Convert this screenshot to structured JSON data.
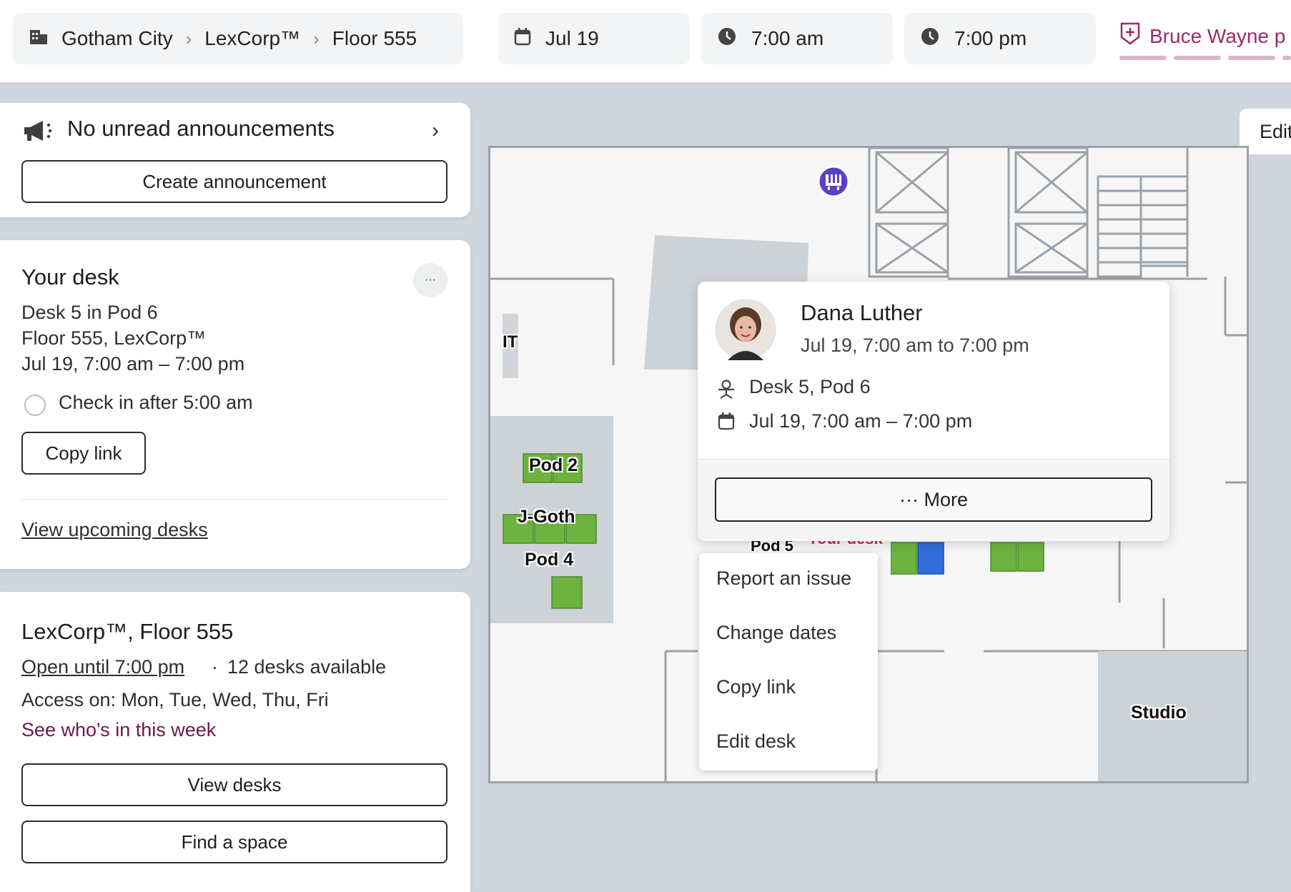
{
  "breadcrumb": [
    "Gotham City",
    "LexCorp™",
    "Floor 555"
  ],
  "filters": {
    "date": "Jul 19",
    "start_time": "7:00 am",
    "end_time": "7:00 pm"
  },
  "user": {
    "name": "Bruce Wayne p"
  },
  "announcements": {
    "title": "No unread announcements",
    "create_button": "Create announcement"
  },
  "your_desk": {
    "title": "Your desk",
    "more_glyph": "···",
    "desk_line": "Desk 5 in Pod 6",
    "location_line": "Floor 555, LexCorp™",
    "time_line": "Jul 19, 7:00 am – 7:00 pm",
    "checkin": "Check in after 5:00 am",
    "copy_link": "Copy link",
    "upcoming_link": "View upcoming desks"
  },
  "floor": {
    "title": "LexCorp™, Floor 555",
    "open_until": "Open until 7:00 pm",
    "separator": "·",
    "availability": "12 desks available",
    "access": "Access on: Mon, Tue, Wed, Thu, Fri",
    "see_who": "See who's in this week",
    "view_desks": "View desks",
    "find_space": "Find a space"
  },
  "map": {
    "edit_tab": "Edit",
    "labels": {
      "it": "IT",
      "pod2": "Pod 2",
      "jgoth": "J-Goth",
      "pod4": "Pod 4",
      "pod5": "Pod 5",
      "your_desk": "Your desk",
      "studio": "Studio"
    }
  },
  "popover": {
    "name": "Dana Luther",
    "time": "Jul 19, 7:00 am to 7:00 pm",
    "desk": "Desk 5, Pod 6",
    "dates": "Jul 19, 7:00 am – 7:00 pm",
    "more_button": "··· More"
  },
  "context_menu": [
    "Report an issue",
    "Change dates",
    "Copy link",
    "Edit desk"
  ],
  "colors": {
    "accent": "#9c2a6a",
    "desk_green": "#6db33f",
    "your_desk_blue": "#2f6fdb",
    "marker_red": "#d9214b"
  }
}
